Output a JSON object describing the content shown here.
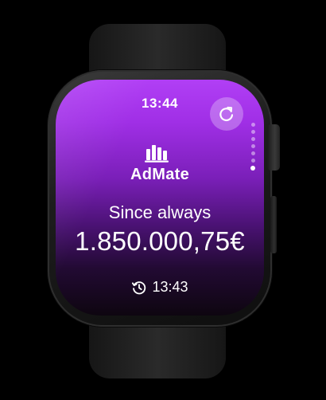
{
  "status_bar": {
    "time": "13:44"
  },
  "icons": {
    "refresh": "refresh-icon",
    "app_logo": "bar-chart-icon",
    "history": "history-clock-icon"
  },
  "app": {
    "name": "AdMate"
  },
  "earnings": {
    "period_label": "Since always",
    "amount": "1.850.000,75€"
  },
  "last_update": {
    "time": "13:43"
  },
  "pager": {
    "count": 7,
    "active_index": 6
  },
  "colors": {
    "accent_top": "#b13ff5",
    "accent_bottom": "#0e0610",
    "text": "#ffffff"
  }
}
